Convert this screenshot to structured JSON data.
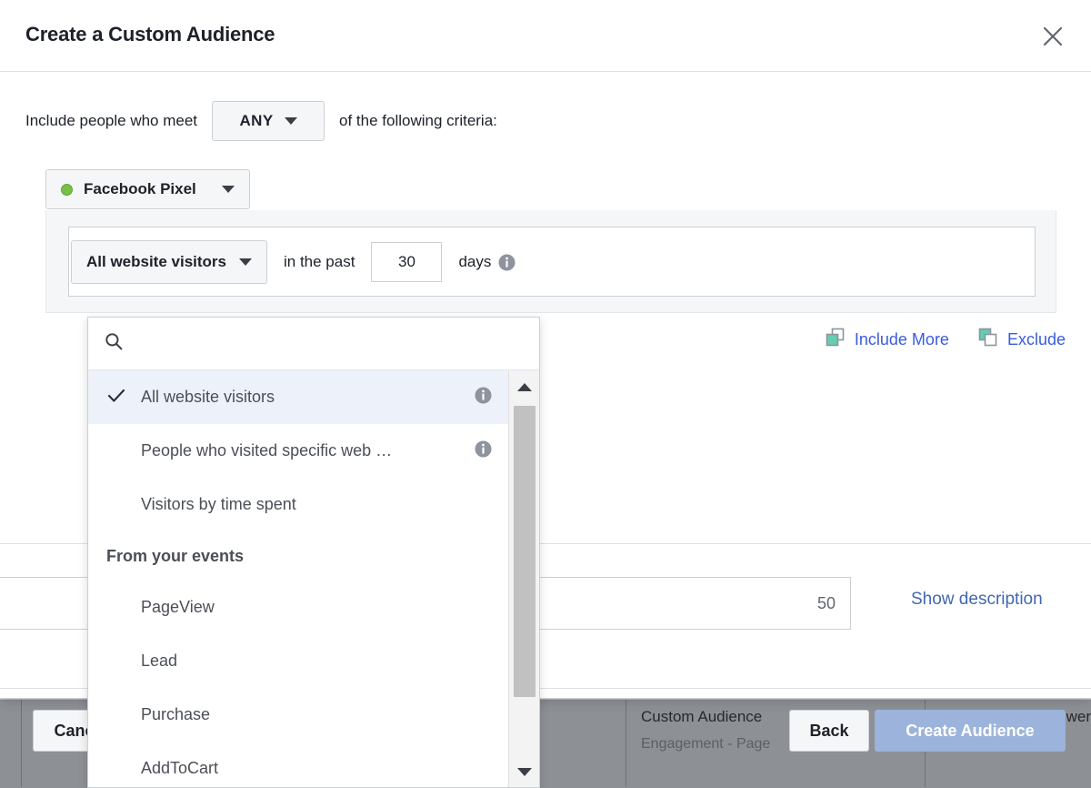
{
  "background": {
    "row": {
      "name": "Custom Audience",
      "subtitle": "Engagement - Page",
      "right_col": "Fewer"
    }
  },
  "modal": {
    "title": "Create a Custom Audience",
    "close_icon": "close-icon",
    "criteria": {
      "prefix": "Include people who meet",
      "operator": "ANY",
      "suffix": "of the following criteria:"
    },
    "source": {
      "label": "Facebook Pixel",
      "status_color": "#76c043"
    },
    "rule": {
      "selected": "All website visitors",
      "in_the_past": "in the past",
      "days_value": "30",
      "days_word": "days"
    },
    "actions": {
      "include_more": "Include More",
      "exclude": "Exclude"
    },
    "name_field": {
      "value": "50",
      "placeholder": "",
      "show_description": "Show description"
    },
    "footer": {
      "cancel": "Cancel",
      "back": "Back",
      "create": "Create Audience"
    }
  },
  "dropdown": {
    "search_placeholder": "",
    "search_value": "",
    "items": [
      {
        "label": "All website visitors",
        "selected": true,
        "info": true
      },
      {
        "label": "People who visited specific web …",
        "selected": false,
        "info": true
      },
      {
        "label": "Visitors by time spent",
        "selected": false,
        "info": false
      }
    ],
    "group_title": "From your events",
    "events": [
      {
        "label": "PageView"
      },
      {
        "label": "Lead"
      },
      {
        "label": "Purchase"
      },
      {
        "label": "AddToCart"
      }
    ]
  },
  "colors": {
    "accent_link": "#4267b2",
    "primary_button": "#9cb4db",
    "icon_green": "#63ceb0",
    "selected_row": "#edf2fa"
  }
}
